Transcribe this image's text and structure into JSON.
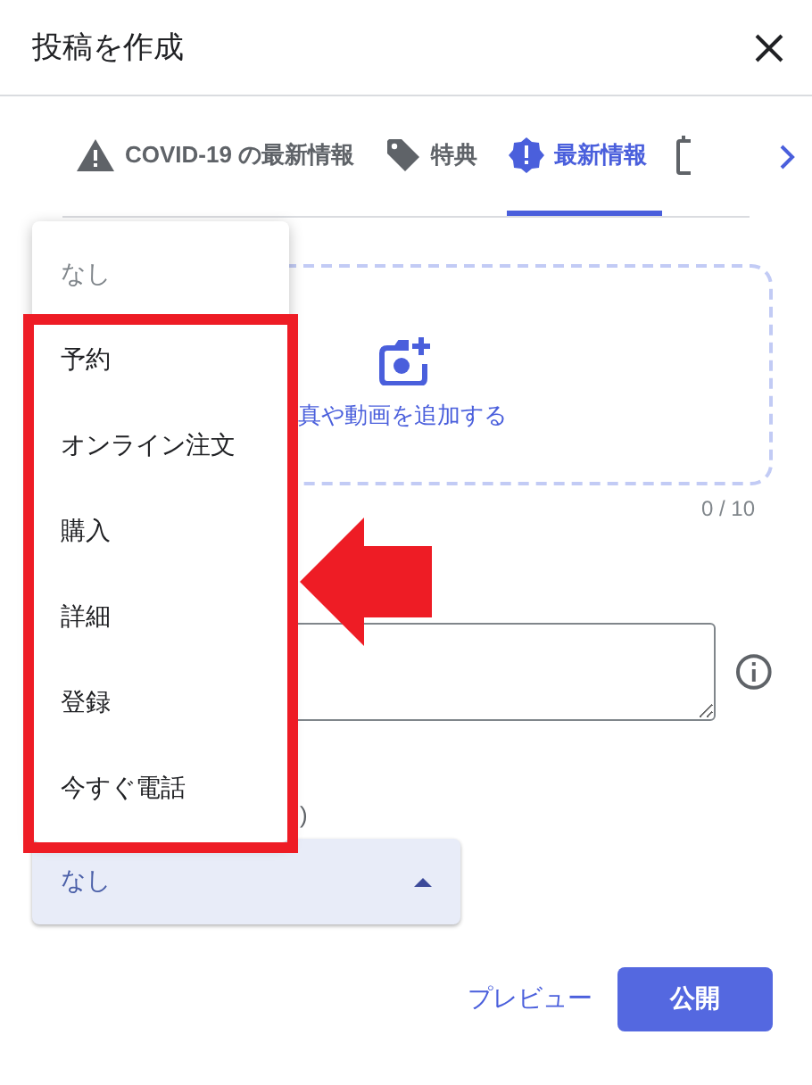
{
  "dialog": {
    "title": "投稿を作成"
  },
  "tabs": [
    {
      "kind": "warning",
      "label": "COVID-19 の最新情報",
      "selected": false
    },
    {
      "kind": "offer",
      "label": "特典",
      "selected": false
    },
    {
      "kind": "update",
      "label": "最新情報",
      "selected": true
    },
    {
      "kind": "event",
      "selected": false
    }
  ],
  "media_upload": {
    "label": "真や動画を追加する",
    "count": "0 / 10"
  },
  "button_section": {
    "label_fragment": ")",
    "select": {
      "value": "なし",
      "expanded": true
    }
  },
  "menu": {
    "items": [
      {
        "label": "なし",
        "disabled": true
      },
      {
        "label": "予約",
        "disabled": false
      },
      {
        "label": "オンライン注文",
        "disabled": false
      },
      {
        "label": "購入",
        "disabled": false
      },
      {
        "label": "詳細",
        "disabled": false
      },
      {
        "label": "登録",
        "disabled": false
      },
      {
        "label": "今すぐ電話",
        "disabled": false
      }
    ]
  },
  "actions": {
    "preview": "プレビュー",
    "publish": "公開"
  }
}
